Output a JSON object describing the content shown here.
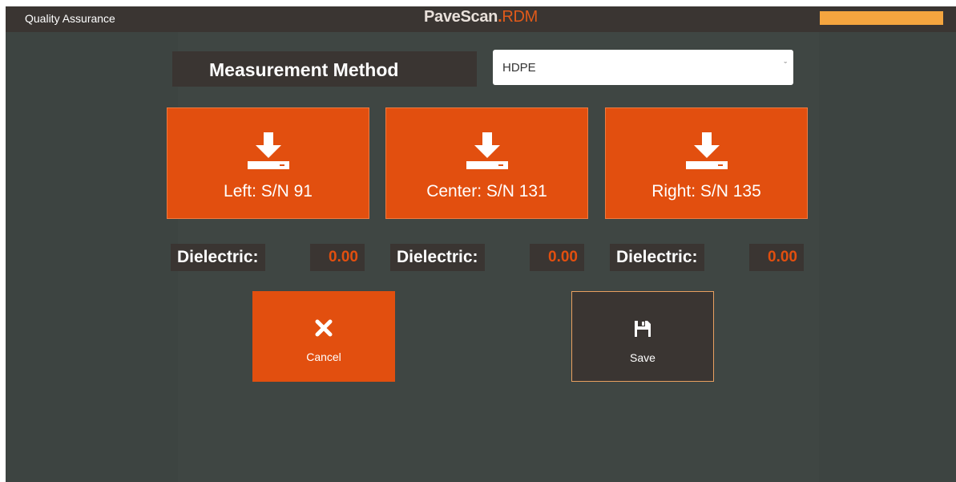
{
  "header": {
    "module_title": "Quality Assurance",
    "brand_main": "PaveScan",
    "brand_dot": ".",
    "brand_suffix": "RDM",
    "status_color": "#f5a53f"
  },
  "measurement": {
    "label": "Measurement Method",
    "selected": "HDPE",
    "chevron": "ˇ"
  },
  "sensors": [
    {
      "label": "Left: S/N 91",
      "icon": "download-icon"
    },
    {
      "label": "Center: S/N 131",
      "icon": "download-icon"
    },
    {
      "label": "Right: S/N 135",
      "icon": "download-icon"
    }
  ],
  "dielectric": [
    {
      "label": "Dielectric:",
      "value": "0.00"
    },
    {
      "label": "Dielectric:",
      "value": "0.00"
    },
    {
      "label": "Dielectric:",
      "value": "0.00"
    }
  ],
  "actions": {
    "cancel_label": "Cancel",
    "cancel_icon": "close-icon",
    "save_label": "Save",
    "save_icon": "floppy-disk-icon"
  },
  "colors": {
    "accent": "#e24f0f",
    "background": "#3d4441",
    "panel": "#3a3532"
  }
}
